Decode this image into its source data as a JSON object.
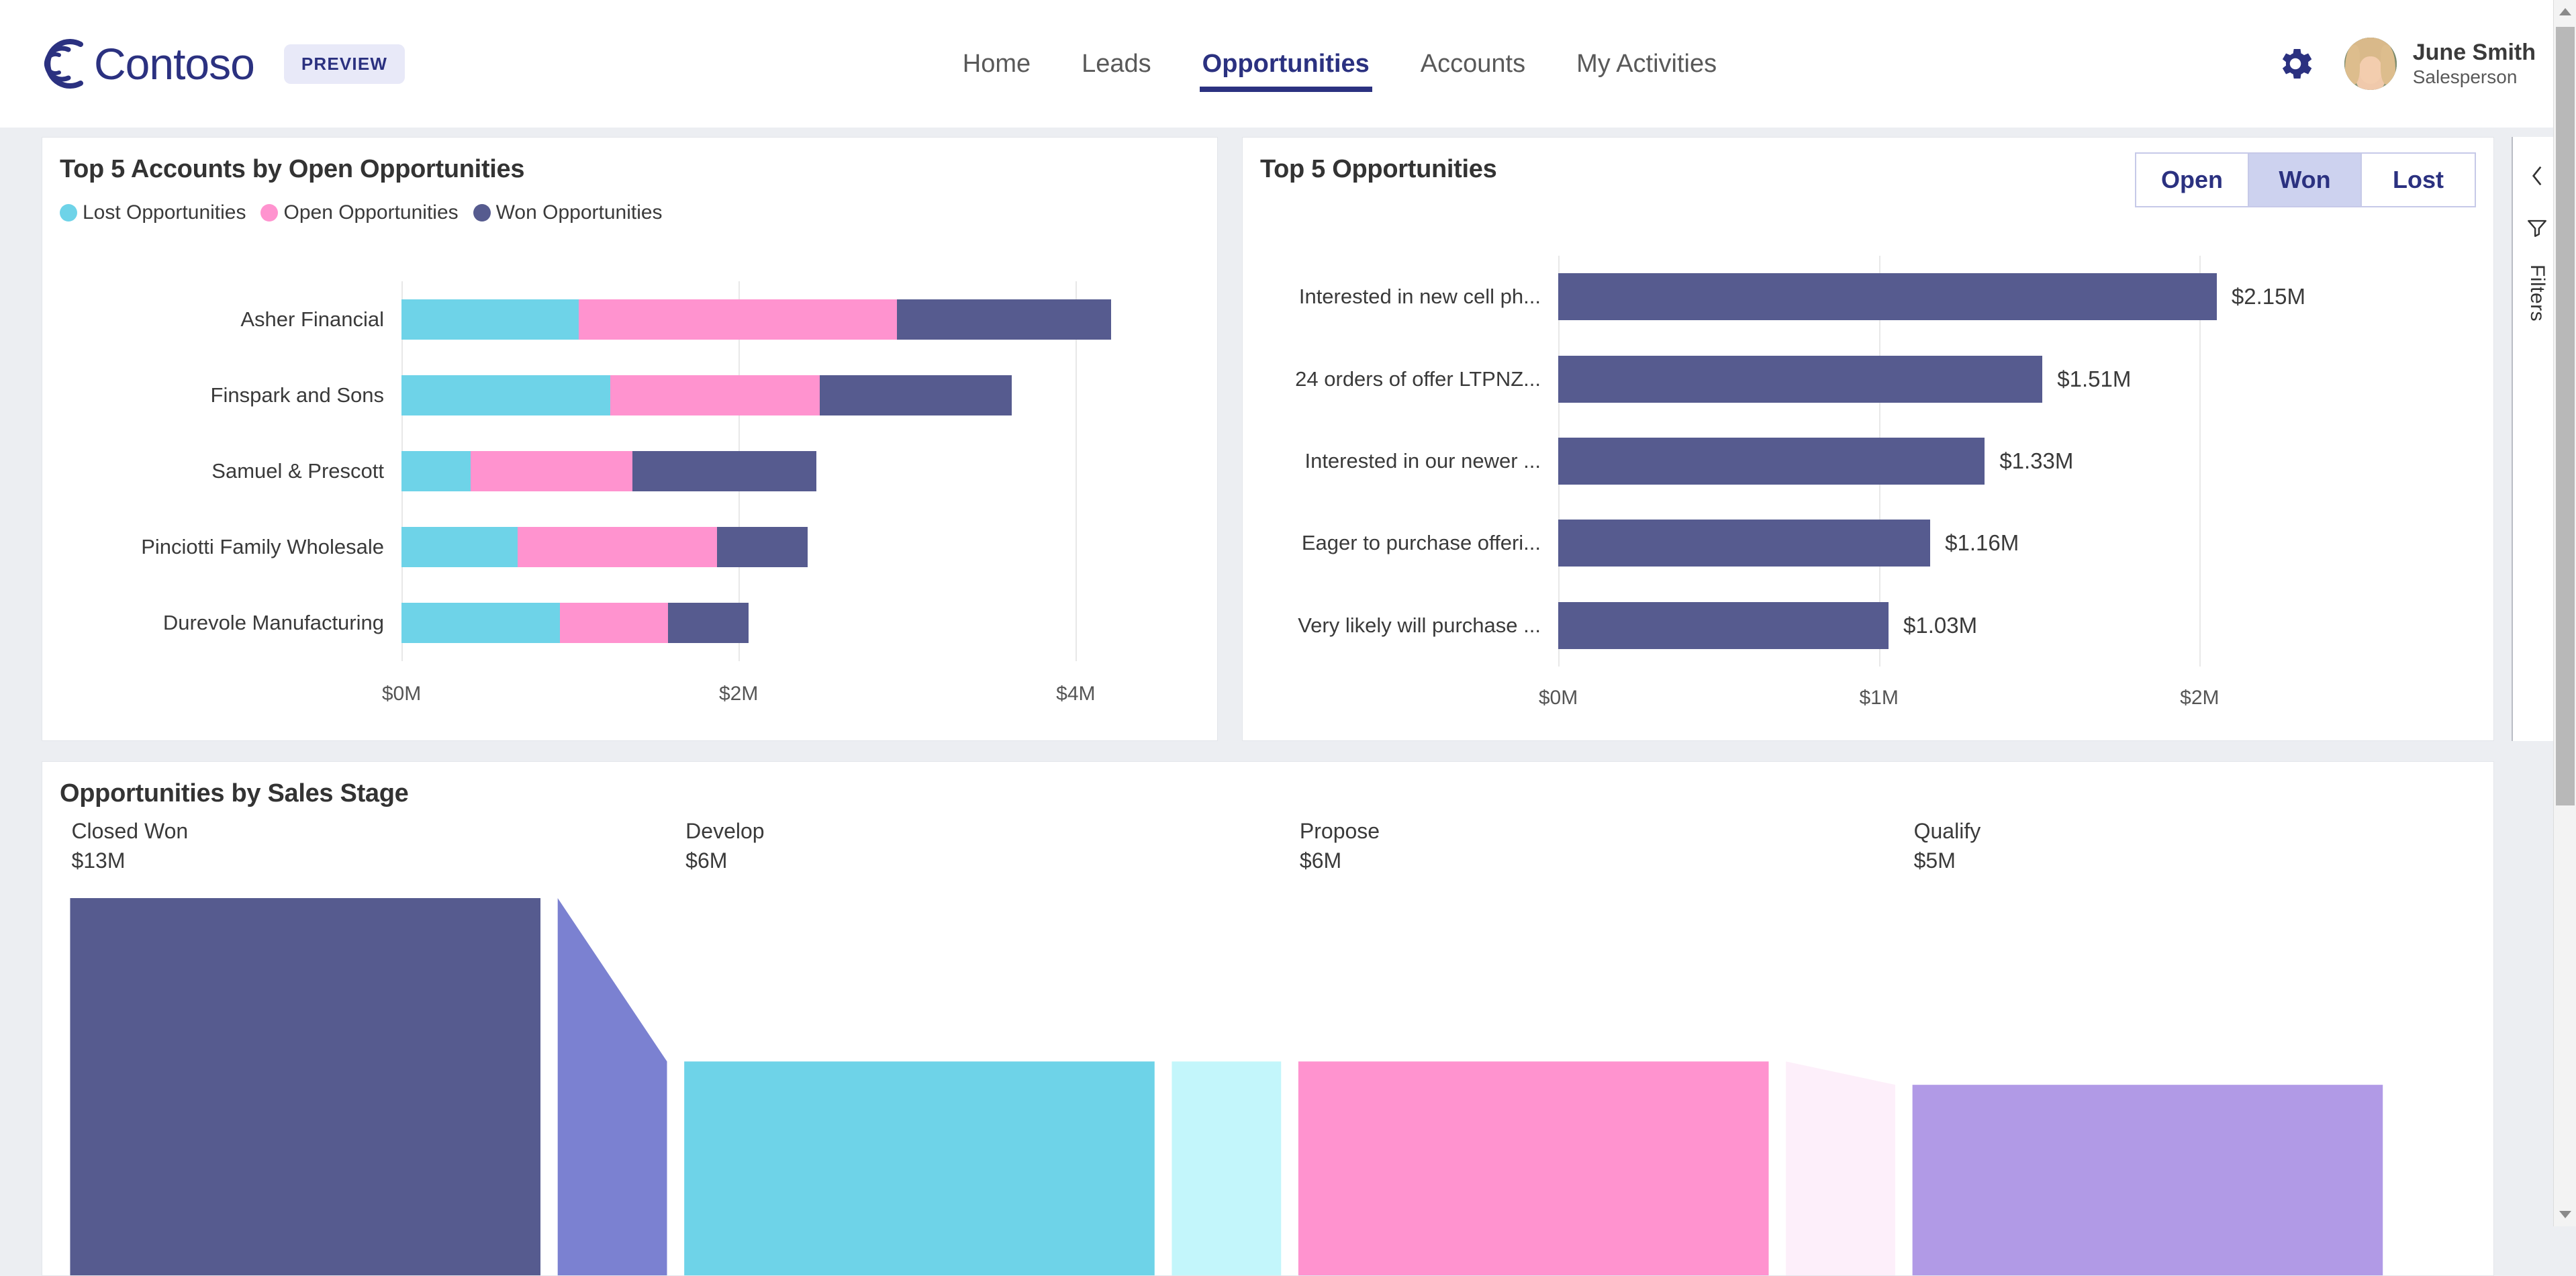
{
  "header": {
    "brand_name": "Contoso",
    "preview_badge": "PREVIEW",
    "nav": [
      {
        "label": "Home",
        "active": false
      },
      {
        "label": "Leads",
        "active": false
      },
      {
        "label": "Opportunities",
        "active": true
      },
      {
        "label": "Accounts",
        "active": false
      },
      {
        "label": "My Activities",
        "active": false
      }
    ],
    "user_name": "June Smith",
    "user_role": "Salesperson"
  },
  "filters_rail": {
    "label": "Filters"
  },
  "accounts_card": {
    "title": "Top 5 Accounts by Open Opportunities",
    "legend": [
      {
        "label": "Lost Opportunities",
        "color": "#6ed3e8"
      },
      {
        "label": "Open Opportunities",
        "color": "#ff93cf"
      },
      {
        "label": "Won Opportunities",
        "color": "#565b8f"
      }
    ]
  },
  "opportunities_card": {
    "title": "Top 5 Opportunities",
    "toggle": [
      {
        "label": "Open",
        "selected": false
      },
      {
        "label": "Won",
        "selected": true
      },
      {
        "label": "Lost",
        "selected": false
      }
    ]
  },
  "funnel_card": {
    "title": "Opportunities by Sales Stage"
  },
  "chart_data": [
    {
      "type": "bar",
      "subtype": "horizontal-stacked",
      "title": "Top 5 Accounts by Open Opportunities",
      "xlabel": "",
      "ylabel": "",
      "xlim": [
        0,
        4.6
      ],
      "xticks": [
        0,
        2,
        4
      ],
      "xtick_labels": [
        "$0M",
        "$2M",
        "$4M"
      ],
      "grid": true,
      "legend_position": "top-left",
      "unit": "USD millions",
      "categories": [
        "Asher Financial",
        "Finspark and Sons",
        "Samuel & Prescott",
        "Pinciotti Family Wholesale",
        "Durevole Manufacturing"
      ],
      "series": [
        {
          "name": "Lost Opportunities",
          "color": "#6ed3e8",
          "values": [
            1.05,
            1.24,
            0.41,
            0.69,
            0.94
          ]
        },
        {
          "name": "Open Opportunities",
          "color": "#ff93cf",
          "values": [
            1.89,
            1.24,
            0.96,
            1.18,
            0.64
          ]
        },
        {
          "name": "Won Opportunities",
          "color": "#565b8f",
          "values": [
            1.27,
            1.14,
            1.09,
            0.54,
            0.48
          ]
        }
      ],
      "totals": [
        4.21,
        3.62,
        2.46,
        2.41,
        2.06
      ]
    },
    {
      "type": "bar",
      "subtype": "horizontal",
      "title": "Top 5 Opportunities",
      "xlabel": "",
      "ylabel": "",
      "xlim": [
        0,
        2.33
      ],
      "xticks": [
        0,
        1,
        2
      ],
      "xtick_labels": [
        "$0M",
        "$1M",
        "$2M"
      ],
      "grid": true,
      "bar_color": "#565b8f",
      "filter_state": "Won",
      "categories": [
        "Interested in new cell ph...",
        "24 orders of offer LTPNZ...",
        "Interested in our newer ...",
        "Eager to purchase offeri...",
        "Very likely will purchase ..."
      ],
      "values": [
        2.15,
        1.51,
        1.33,
        1.16,
        1.03
      ],
      "data_labels": [
        "$2.15M",
        "$1.51M",
        "$1.33M",
        "$1.16M",
        "$1.03M"
      ]
    },
    {
      "type": "funnel",
      "title": "Opportunities by Sales Stage",
      "unit": "USD millions",
      "stages": [
        {
          "label": "Closed Won",
          "value_label": "$13M",
          "value": 13,
          "color": "#565b8f",
          "connector_color": "#7b81d1"
        },
        {
          "label": "Develop",
          "value_label": "$6M",
          "value": 6,
          "color": "#6ed3e8",
          "connector_color": "#c3f6fb"
        },
        {
          "label": "Propose",
          "value_label": "$6M",
          "value": 6,
          "color": "#ff93cf",
          "connector_color": "#fdeffa"
        },
        {
          "label": "Qualify",
          "value_label": "$5M",
          "value": 5,
          "color": "#b19ae6",
          "connector_color": "#f3eefc"
        }
      ]
    }
  ]
}
